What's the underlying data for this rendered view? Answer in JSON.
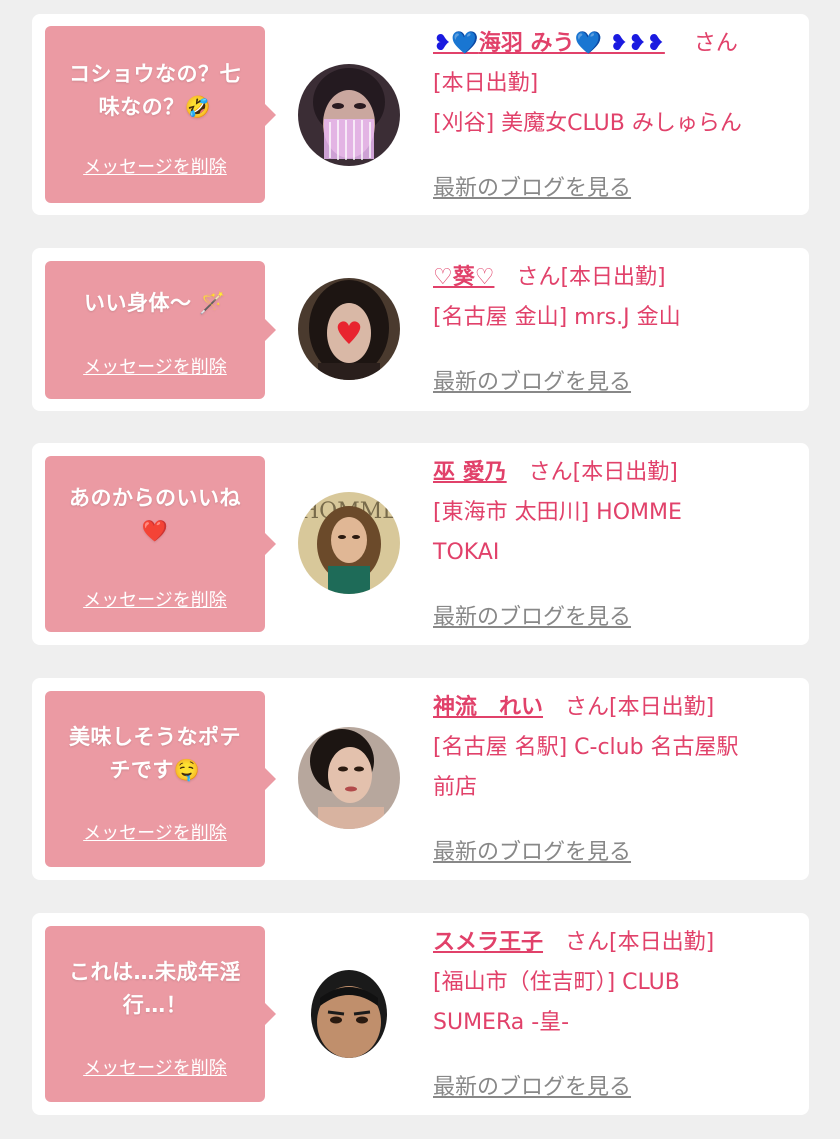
{
  "messages": [
    {
      "bubble_text_1": "コショウなの？七",
      "bubble_text_2": "味なの？🤣",
      "delete_label": "メッセージを削除",
      "name_prefix": "❥💙",
      "name": "海羽 みう",
      "name_suffix": "💙 ❥❥❥",
      "honorific": "さん",
      "status": "[本日出勤]",
      "shop_1": "[刈谷] 美魔女CLUB みしゅらん",
      "shop_2": "",
      "blog_link": "最新のブログを見る"
    },
    {
      "bubble_text_1": "いい身体〜 🪄",
      "bubble_text_2": "",
      "delete_label": "メッセージを削除",
      "name": "♡葵♡",
      "honorific": "さん[本日出勤]",
      "shop_1": "[名古屋 金山] mrs.J 金山",
      "blog_link": "最新のブログを見る"
    },
    {
      "bubble_text_1": "あのからのいいね",
      "bubble_text_2": "❤️",
      "delete_label": "メッセージを削除",
      "name": "巫 愛乃",
      "honorific": "さん[本日出勤]",
      "shop_1": "[東海市 太田川] HOMME",
      "shop_2": "TOKAI",
      "blog_link": "最新のブログを見る"
    },
    {
      "bubble_text_1": "美味しそうなポテ",
      "bubble_text_2": "チです🤤",
      "delete_label": "メッセージを削除",
      "name": "神流　れい",
      "honorific": "さん[本日出勤]",
      "shop_1": "[名古屋 名駅] C-club 名古屋駅",
      "shop_2": "前店",
      "blog_link": "最新のブログを見る"
    },
    {
      "bubble_text_1": "これは…未成年淫",
      "bubble_text_2": "行…！",
      "delete_label": "メッセージを削除",
      "name": "スメラ王子",
      "honorific": "さん[本日出勤]",
      "shop_1": "[福山市（住吉町）] CLUB",
      "shop_2": "SUMERa -皇-",
      "blog_link": "最新のブログを見る"
    }
  ],
  "colors": {
    "page_bg": "#efefef",
    "card_bg": "#ffffff",
    "bubble_bg": "#eb9aa3",
    "accent_pink": "#e1416a",
    "link_gray": "#888888",
    "name_deco_blue": "#1a1ae0"
  }
}
